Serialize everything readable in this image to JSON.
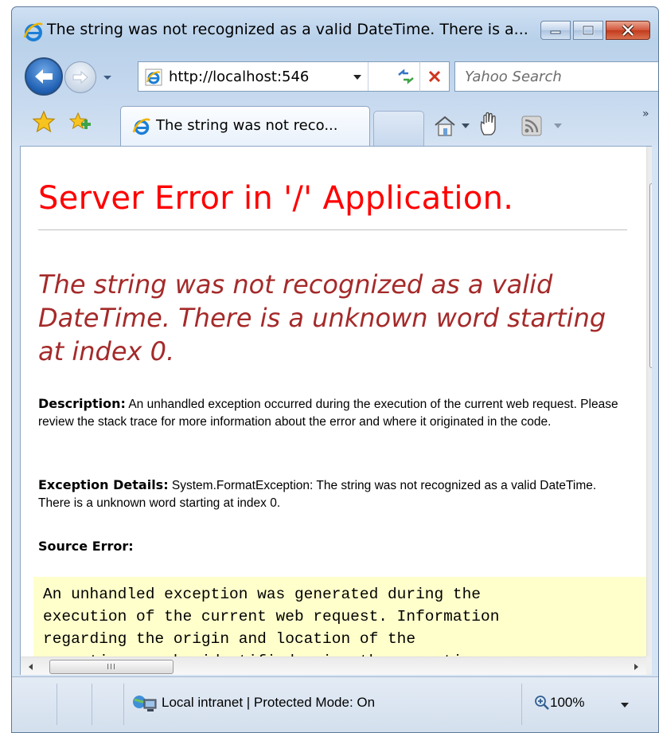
{
  "window": {
    "title": "The string was not recognized as a valid DateTime. There is a...",
    "caption_buttons": {
      "minimize": "minimize",
      "maximize": "maximize",
      "close": "close"
    }
  },
  "nav": {
    "address": "http://localhost:546",
    "search_placeholder": "Yahoo Search",
    "icons": [
      "back-icon",
      "forward-icon",
      "refresh-icon",
      "stop-icon"
    ]
  },
  "tabs": [
    {
      "label": "The string was not reco...",
      "active": true
    }
  ],
  "command_bar": {
    "icons": [
      "home-icon",
      "research-hand-icon",
      "feeds-icon"
    ],
    "overflow": "»"
  },
  "page": {
    "heading": "Server Error in '/' Application.",
    "error_message": "The string was not recognized as a valid DateTime. There is a unknown word starting at index 0.",
    "description_label": "Description:",
    "description_text": "An unhandled exception occurred during the execution of the current web request. Please review the stack trace for more information about the error and where it originated in the code.",
    "exception_label": "Exception Details:",
    "exception_text": "System.FormatException: The string was not recognized as a valid DateTime. There is a unknown word starting at index 0.",
    "source_error_label": "Source Error:",
    "source_error_text": "An unhandled exception was generated during the\nexecution of the current web request. Information\nregarding the origin and location of the\nexception can be identified using the exception"
  },
  "status": {
    "zone": "Local intranet | Protected Mode: On",
    "zoom": "100%"
  },
  "colors": {
    "heading": "#ff0000",
    "error_message": "#a52a2a",
    "source_box_bg": "#ffffcc",
    "frame": "#b9d1ea"
  }
}
